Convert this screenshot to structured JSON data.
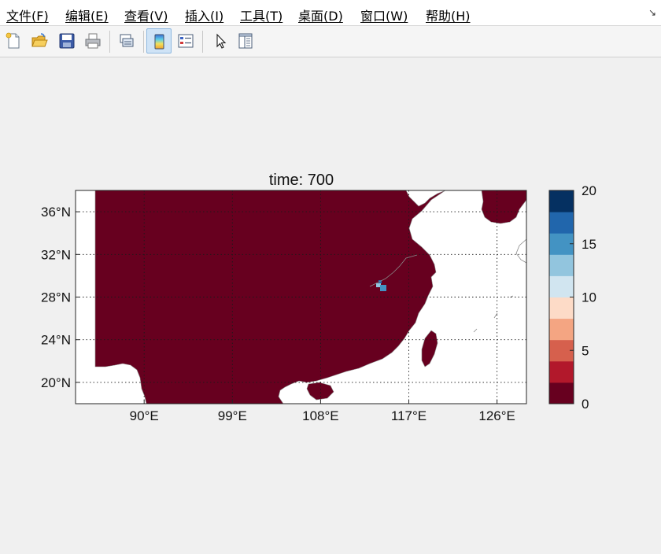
{
  "menu": {
    "items": [
      {
        "key": "file",
        "label": "文件(F)"
      },
      {
        "key": "edit",
        "label": "编辑(E)"
      },
      {
        "key": "view",
        "label": "查看(V)"
      },
      {
        "key": "insert",
        "label": "插入(I)"
      },
      {
        "key": "tools",
        "label": "工具(T)"
      },
      {
        "key": "desktop",
        "label": "桌面(D)"
      },
      {
        "key": "window",
        "label": "窗口(W)"
      },
      {
        "key": "help",
        "label": "帮助(H)"
      }
    ],
    "dock_arrow": "↘"
  },
  "toolbar": {
    "buttons": [
      {
        "key": "new",
        "icon": "new-figure-icon"
      },
      {
        "key": "open",
        "icon": "open-file-icon"
      },
      {
        "key": "save",
        "icon": "save-icon"
      },
      {
        "key": "print",
        "icon": "print-icon"
      },
      {
        "key": "link",
        "icon": "link-plot-icon"
      },
      {
        "key": "colorbar",
        "icon": "colorbar-icon",
        "active": true
      },
      {
        "key": "legend",
        "icon": "legend-icon"
      },
      {
        "key": "pointer",
        "icon": "edit-plot-pointer-icon"
      },
      {
        "key": "property-inspector",
        "icon": "property-inspector-icon"
      }
    ]
  },
  "chart_data": {
    "type": "heatmap",
    "title": "time: 700",
    "xlim": [
      83,
      129
    ],
    "ylim": [
      18,
      38
    ],
    "xticks": [
      90,
      99,
      108,
      117,
      126
    ],
    "xtick_labels": [
      "90°E",
      "99°E",
      "108°E",
      "117°E",
      "126°E"
    ],
    "yticks": [
      20,
      24,
      28,
      32,
      36
    ],
    "ytick_labels": [
      "20°N",
      "24°N",
      "28°N",
      "32°N",
      "36°N"
    ],
    "grid": "dotted",
    "field_value_over_land": 0,
    "local_patch": {
      "lon": 115.8,
      "lat": 29.2,
      "values": [
        13,
        15,
        17
      ]
    },
    "colorbar": {
      "position": "right",
      "min": 0,
      "max": 20,
      "levels": 10,
      "ticks": [
        0,
        5,
        10,
        15,
        20
      ],
      "tick_labels": [
        "0",
        "5",
        "10",
        "15",
        "20"
      ],
      "colors": [
        "#67001f",
        "#b2182b",
        "#d6604d",
        "#f4a582",
        "#fddbc7",
        "#d1e5f0",
        "#92c5de",
        "#4393c3",
        "#2166ac",
        "#053061"
      ]
    },
    "colors": {
      "land": "#67001f",
      "ocean": "#ffffff",
      "coast": "#8a8a8a"
    }
  }
}
